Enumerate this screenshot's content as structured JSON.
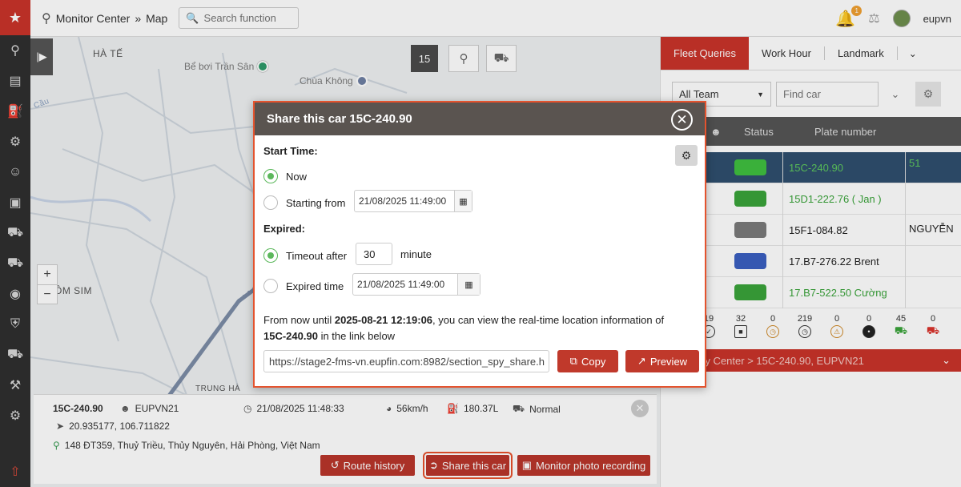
{
  "app": {
    "breadcrumb": {
      "section": "Monitor Center",
      "separator": "»",
      "page": "Map"
    },
    "search_placeholder": "Search function",
    "notification_count": "1",
    "username": "eupvn"
  },
  "map": {
    "cluster_count": "15",
    "labels": {
      "ha_te": "HÀ TẾ",
      "om_sim": "ÔM SIM",
      "trung_ha": "TRUNG HÀ",
      "lo_river": "Cầu"
    },
    "pois": {
      "pool": "Bể bơi Trần Sân",
      "temple": "Chùa Không"
    },
    "zoom_in": "+",
    "zoom_out": "−"
  },
  "vehicle_info": {
    "plate": "15C-240.90",
    "driver": "EUPVN21",
    "datetime": "21/08/2025 11:48:33",
    "speed": "56km/h",
    "fuel": "180.37L",
    "status": "Normal",
    "coords": "20.935177, 106.711822",
    "address": "148 ĐT359, Thuỷ Triều, Thủy Nguyên, Hải Phòng, Việt Nam",
    "buttons": {
      "route_history": "Route history",
      "share": "Share this car",
      "photo": "Monitor photo recording"
    }
  },
  "right_panel": {
    "tabs": [
      "Fleet Queries",
      "Work Hour",
      "Landmark"
    ],
    "team_select": "All Team",
    "find_placeholder": "Find car",
    "columns": {
      "status": "Status",
      "plate": "Plate number"
    },
    "rows": [
      {
        "plate": "15C-240.90",
        "extra": "51",
        "color": "#3fbf3f",
        "plate_color": "#5ec95e"
      },
      {
        "plate": "15D1-222.76 ( Jan )",
        "extra": "",
        "color": "#3aa33a",
        "plate_color": "#3aa33a"
      },
      {
        "plate": "15F1-084.82",
        "extra": "NGUYỄN",
        "color": "#7a7a7a",
        "plate_color": "#222222"
      },
      {
        "plate": "17.B7-276.22 Brent",
        "extra": "",
        "color": "#3a5fc0",
        "plate_color": "#222222"
      },
      {
        "plate": "17.B7-522.50 Cường",
        "extra": "",
        "color": "#3aa33a",
        "plate_color": "#3aa33a"
      }
    ],
    "counts": [
      "19",
      "32",
      "0",
      "219",
      "0",
      "0",
      "45",
      "0"
    ],
    "quality_text": "mality Center > 15C-240.90, EUPVN21"
  },
  "modal": {
    "title": "Share this car 15C-240.90",
    "start_label": "Start Time:",
    "now_label": "Now",
    "starting_from_label": "Starting from",
    "start_datetime": "21/08/2025 11:49:00",
    "expired_label": "Expired:",
    "timeout_label": "Timeout after",
    "timeout_value": "30",
    "minute_label": "minute",
    "expired_time_label": "Expired time",
    "expired_datetime": "21/08/2025 11:49:00",
    "msg_prefix": "From now until ",
    "msg_until": "2025-08-21 12:19:06",
    "msg_mid": ", you can view the real-time location information of ",
    "msg_plate": "15C-240.90",
    "msg_suffix": " in the link below",
    "link": "https://stage2-fms-vn.eupfin.com:8982/section_spy_share.h",
    "copy_label": "Copy",
    "preview_label": "Preview"
  }
}
